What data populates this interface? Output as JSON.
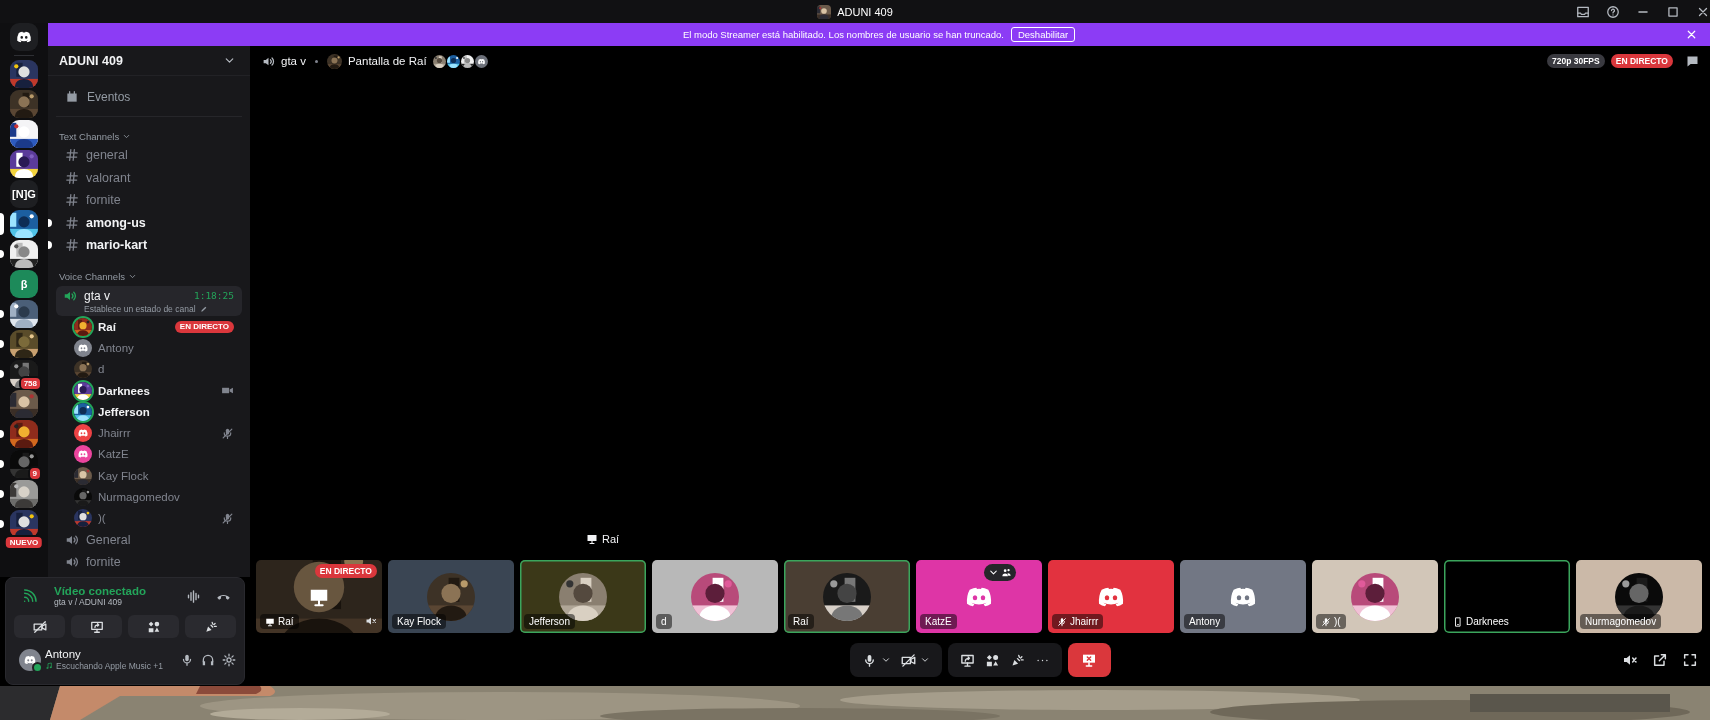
{
  "title_bar": {
    "title": "ADUNI 409"
  },
  "streamer_banner": {
    "message": "El modo Streamer está habilitado. Los nombres de usuario se han truncado.",
    "button": "Deshabilitar"
  },
  "servers": [
    {
      "kind": "home",
      "selected": false,
      "unread": false
    },
    {
      "kind": "picture",
      "selected": false,
      "unread": false
    },
    {
      "kind": "picture",
      "selected": false,
      "unread": false
    },
    {
      "kind": "picture",
      "selected": false,
      "unread": false
    },
    {
      "kind": "picture",
      "selected": false,
      "unread": false
    },
    {
      "kind": "text",
      "label": "[N]G",
      "color": "#1e1f22",
      "selected": false,
      "unread": false
    },
    {
      "kind": "picture",
      "selected": true,
      "unread": false
    },
    {
      "kind": "picture",
      "selected": false,
      "unread": true
    },
    {
      "kind": "text",
      "label": "β",
      "color": "#1d8a5a",
      "selected": false,
      "unread": false
    },
    {
      "kind": "picture",
      "selected": false,
      "unread": true
    },
    {
      "kind": "picture",
      "selected": false,
      "unread": true
    },
    {
      "kind": "picture",
      "selected": false,
      "unread": true,
      "badge": {
        "kind": "count",
        "text": "758"
      }
    },
    {
      "kind": "picture",
      "selected": false,
      "unread": false
    },
    {
      "kind": "picture",
      "selected": false,
      "unread": true
    },
    {
      "kind": "picture",
      "selected": false,
      "unread": true,
      "badge": {
        "kind": "count",
        "text": "9"
      }
    },
    {
      "kind": "picture",
      "selected": false,
      "unread": true
    },
    {
      "kind": "picture",
      "selected": false,
      "unread": true,
      "badge": {
        "kind": "new",
        "text": "NUEVO"
      }
    }
  ],
  "server_header": {
    "name": "ADUNI 409"
  },
  "events": {
    "label": "Eventos"
  },
  "text_channels": {
    "heading": "Text Channels",
    "channels": [
      {
        "name": "general",
        "unread": false
      },
      {
        "name": "valorant",
        "unread": false
      },
      {
        "name": "fornite",
        "unread": false
      },
      {
        "name": "among-us",
        "unread": true
      },
      {
        "name": "mario-kart",
        "unread": true
      }
    ]
  },
  "voice_channels": {
    "heading": "Voice Channels",
    "channels": [
      {
        "name": "gta v",
        "selected": true,
        "timer": "1:18:25",
        "status": "Establece un estado de canal",
        "members": [
          {
            "name": "Raí",
            "speaking": true,
            "kind": "picture",
            "indicator": {
              "kind": "live",
              "label": "EN DIRECTO"
            }
          },
          {
            "name": "Antony",
            "speaking": false,
            "kind": "discord",
            "color": "#80848e"
          },
          {
            "name": "d",
            "speaking": false,
            "kind": "picture"
          },
          {
            "name": "Darknees",
            "speaking": true,
            "kind": "picture",
            "indicator": {
              "kind": "video"
            }
          },
          {
            "name": "Jefferson",
            "speaking": true,
            "kind": "picture"
          },
          {
            "name": "Jhairrr",
            "speaking": false,
            "kind": "discord",
            "color": "#ed4245",
            "indicator": {
              "kind": "deafened"
            }
          },
          {
            "name": "KatzE",
            "speaking": false,
            "kind": "discord",
            "color": "#eb459e"
          },
          {
            "name": "Kay Flock",
            "speaking": false,
            "kind": "picture"
          },
          {
            "name": "Nurmagomedov",
            "speaking": false,
            "kind": "picture"
          },
          {
            "name": ")(",
            "speaking": false,
            "kind": "picture",
            "indicator": {
              "kind": "deafened"
            }
          }
        ]
      },
      {
        "name": "General",
        "selected": false
      },
      {
        "name": "fornite",
        "selected": false
      }
    ]
  },
  "voice_panel": {
    "status": "Vídeo conectado",
    "location": "gta v / ADUNI 409"
  },
  "user_panel": {
    "name": "Antony",
    "activity": "Escuchando Apple Music +1",
    "online": true
  },
  "stream_header": {
    "channel": "gta v",
    "stream_title": "Pantalla de Raí",
    "viewers": [
      {
        "kind": "picture"
      },
      {
        "kind": "picture"
      },
      {
        "kind": "picture"
      },
      {
        "kind": "discord"
      }
    ],
    "quality": "720p 30FPS",
    "live_label": "EN DIRECTO"
  },
  "stream_label": {
    "name": "Raí"
  },
  "tiles": [
    {
      "name": "Raí",
      "kind": "stream",
      "speaking": false,
      "live_label": "EN DIRECTO",
      "sharing_screen": true
    },
    {
      "name": "Kay Flock",
      "kind": "avatar",
      "color": "#3a4553",
      "speaking": false
    },
    {
      "name": "Jefferson",
      "kind": "avatar",
      "color": "#3b3818",
      "speaking": true
    },
    {
      "name": "d",
      "kind": "avatar",
      "color": "#b8b8b8",
      "speaking": false
    },
    {
      "name": "Raí",
      "kind": "avatar",
      "color": "#4a3e33",
      "speaking": true
    },
    {
      "name": "KatzE",
      "kind": "discord",
      "color": "#de35a6",
      "speaking": false,
      "show_options": true
    },
    {
      "name": "Jhairrr",
      "kind": "discord",
      "color": "#e2323f",
      "speaking": false,
      "deafened": true
    },
    {
      "name": "Antony",
      "kind": "discord",
      "color": "#727784",
      "speaking": false
    },
    {
      "name": ")(",
      "kind": "avatar",
      "color": "#d2c6b8",
      "speaking": false,
      "deafened": true
    },
    {
      "name": "Darknees",
      "kind": "empty",
      "color": "#000000",
      "speaking": true,
      "on_mobile": true
    },
    {
      "name": "Nurmagomedov",
      "kind": "avatar",
      "color": "#cbb9a8",
      "speaking": false
    }
  ]
}
